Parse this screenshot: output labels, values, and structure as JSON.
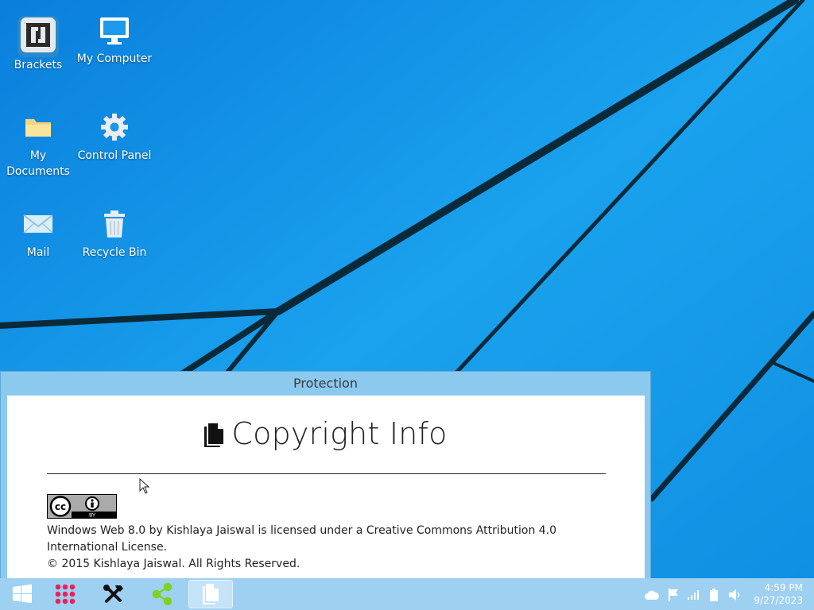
{
  "desktop": {
    "icons": [
      {
        "label": "Brackets"
      },
      {
        "label": "My Computer"
      },
      {
        "label": "My Documents"
      },
      {
        "label": "Control Panel"
      },
      {
        "label": "Mail"
      },
      {
        "label": "Recycle Bin"
      }
    ]
  },
  "window": {
    "title": "Protection",
    "heading": "Copyright Info",
    "badge": {
      "left": "cc",
      "right": "BY"
    },
    "license_line": "Windows Web 8.0 by Kishlaya Jaiswal is licensed under a Creative Commons Attribution 4.0 International License.",
    "copyright_line": "© 2015 Kishlaya Jaiswal. All Rights Reserved."
  },
  "taskbar": {
    "buttons": [
      {
        "icon": "windows-start-icon"
      },
      {
        "icon": "apps-grid-icon"
      },
      {
        "icon": "tools-icon"
      },
      {
        "icon": "share-icon"
      },
      {
        "icon": "document-icon",
        "active": true
      }
    ],
    "tray": [
      "cloud-icon",
      "flag-icon",
      "signal-icon",
      "battery-icon",
      "volume-icon"
    ],
    "clock": {
      "time": "4:59 PM",
      "date": "9/27/2023"
    }
  },
  "colors": {
    "desktop": "#1596e8",
    "window_frame": "#8cc9ee",
    "taskbar": "#9ed0f2",
    "apps_icon": "#e8235b",
    "share_icon": "#7ed321"
  }
}
